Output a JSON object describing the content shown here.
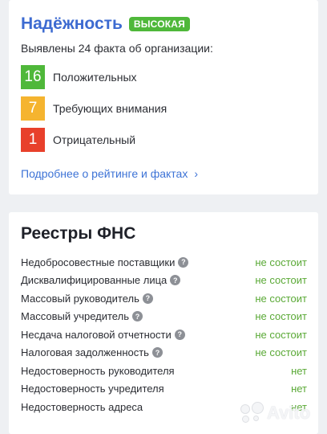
{
  "reliability": {
    "title": "Надёжность",
    "badge": "ВЫСОКАЯ",
    "subtitle": "Выявлены 24 факта об организации:",
    "facts": [
      {
        "count": "16",
        "label": "Положительных",
        "color": "#4fb83a"
      },
      {
        "count": "7",
        "label": "Требующих внимания",
        "color": "#f5b42f"
      },
      {
        "count": "1",
        "label": "Отрицательный",
        "color": "#e8402b"
      }
    ],
    "more_link": "Подробнее о рейтинге и фактах",
    "more_chevron": "chevron-right-icon"
  },
  "fns": {
    "title": "Реестры ФНС",
    "rows": [
      {
        "label": "Недобросовестные поставщики",
        "status": "не состоит",
        "help": true
      },
      {
        "label": "Дисквалифицированные лица",
        "status": "не состоит",
        "help": true
      },
      {
        "label": "Массовый руководитель",
        "status": "не состоит",
        "help": true
      },
      {
        "label": "Массовый учредитель",
        "status": "не состоит",
        "help": true
      },
      {
        "label": "Несдача налоговой отчетности",
        "status": "не состоит",
        "help": true
      },
      {
        "label": "Налоговая задолженность",
        "status": "не состоит",
        "help": true
      },
      {
        "label": "Недостоверность руководителя",
        "status": "нет",
        "help": false
      },
      {
        "label": "Недостоверность учредителя",
        "status": "нет",
        "help": false
      },
      {
        "label": "Недостоверность адреса",
        "status": "нет",
        "help": false
      }
    ],
    "help_icon": "?"
  },
  "colors": {
    "accent": "#3d6bd1",
    "status_ok": "#5aa936"
  },
  "watermark": {
    "text": "Avito"
  }
}
